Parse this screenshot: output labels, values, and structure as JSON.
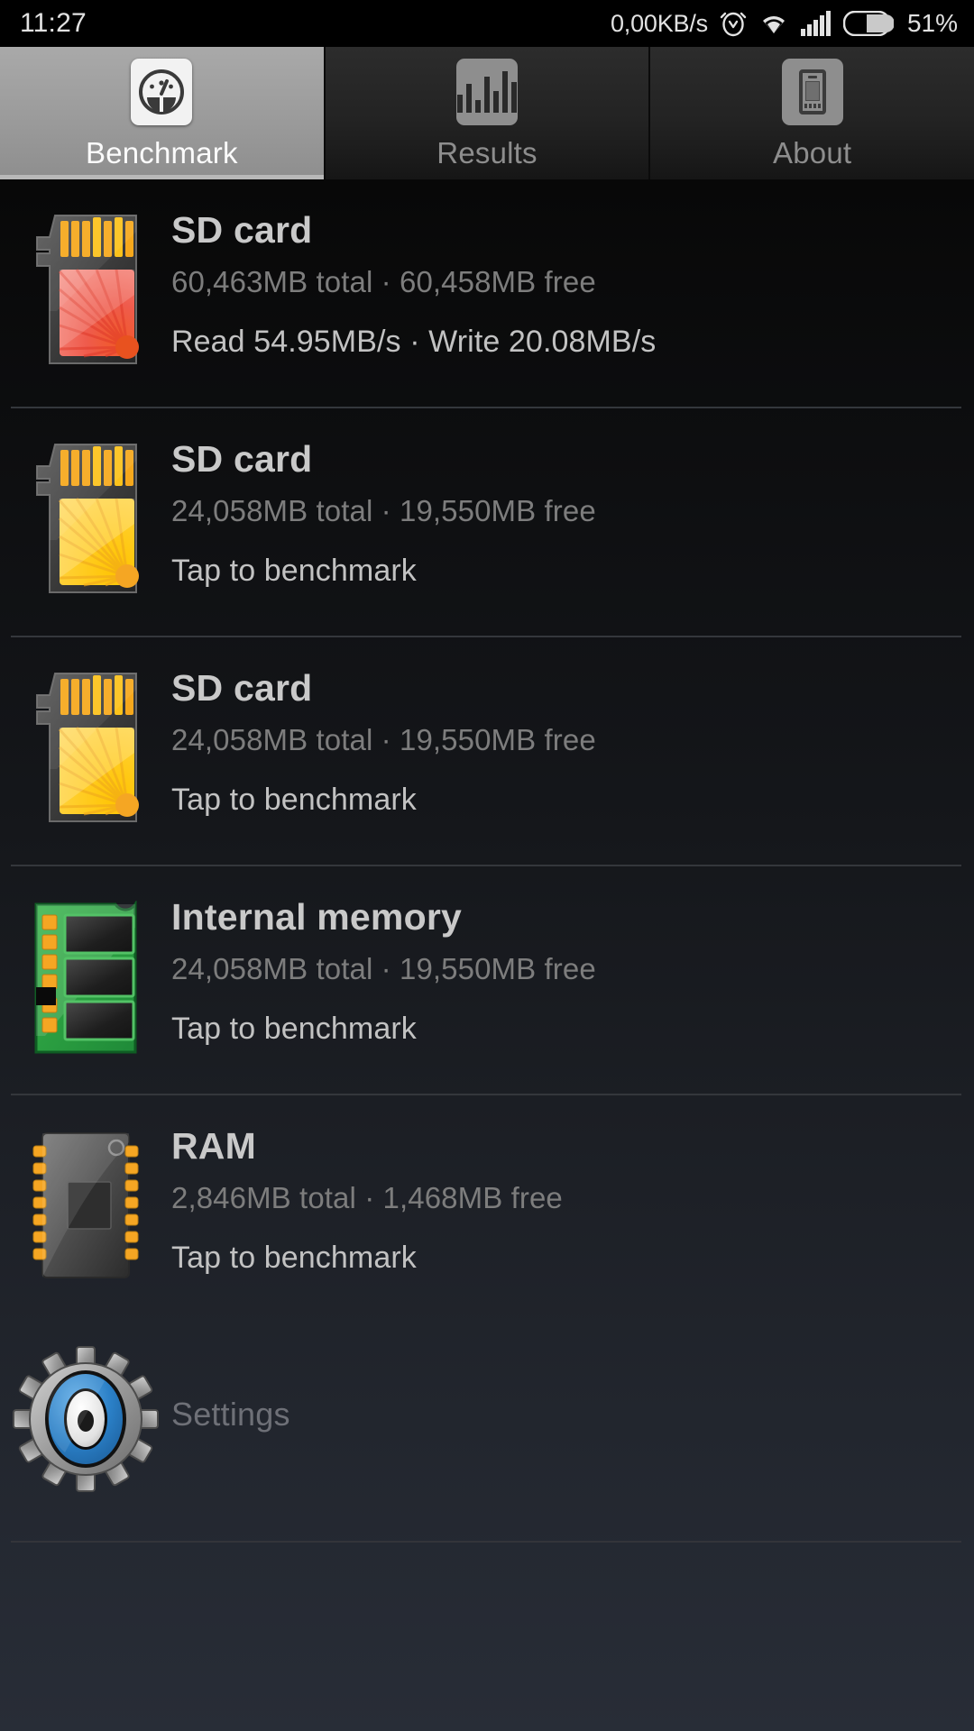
{
  "statusbar": {
    "clock": "11:27",
    "network_speed": "0,00KB/s",
    "battery_percent": "51%",
    "icons": [
      "alarm-clock-icon",
      "wifi-icon",
      "signal-bars-icon",
      "battery-icon"
    ]
  },
  "tabs": [
    {
      "label": "Benchmark",
      "icon": "speedometer-icon",
      "active": true
    },
    {
      "label": "Results",
      "icon": "bar-chart-icon",
      "active": false
    },
    {
      "label": "About",
      "icon": "phone-icon",
      "active": false
    }
  ],
  "rows": [
    {
      "title": "SD card",
      "subtitle": "60,463MB total · 60,458MB free",
      "action": "Read 54.95MB/s · Write 20.08MB/s",
      "icon": "sd-card-icon-red"
    },
    {
      "title": "SD card",
      "subtitle": "24,058MB total · 19,550MB free",
      "action": "Tap to benchmark",
      "icon": "sd-card-icon-yellow"
    },
    {
      "title": "SD card",
      "subtitle": "24,058MB total · 19,550MB free",
      "action": "Tap to benchmark",
      "icon": "sd-card-icon-yellow"
    },
    {
      "title": "Internal memory",
      "subtitle": "24,058MB total · 19,550MB free",
      "action": "Tap to benchmark",
      "icon": "memory-module-icon"
    },
    {
      "title": "RAM",
      "subtitle": "2,846MB total · 1,468MB free",
      "action": "Tap to benchmark",
      "icon": "ram-chip-icon"
    }
  ],
  "settings": {
    "label": "Settings",
    "icon": "gear-icon"
  },
  "colors": {
    "accent_red": "#e8433a",
    "accent_yellow": "#ffc700",
    "accent_green": "#2aa34a",
    "accent_blue": "#2b7ec4",
    "tab_active_bg": "#9c9c9c",
    "divider": "#34373c",
    "title_text": "#c9c9c9",
    "subtitle_text": "#7d7d7d"
  }
}
